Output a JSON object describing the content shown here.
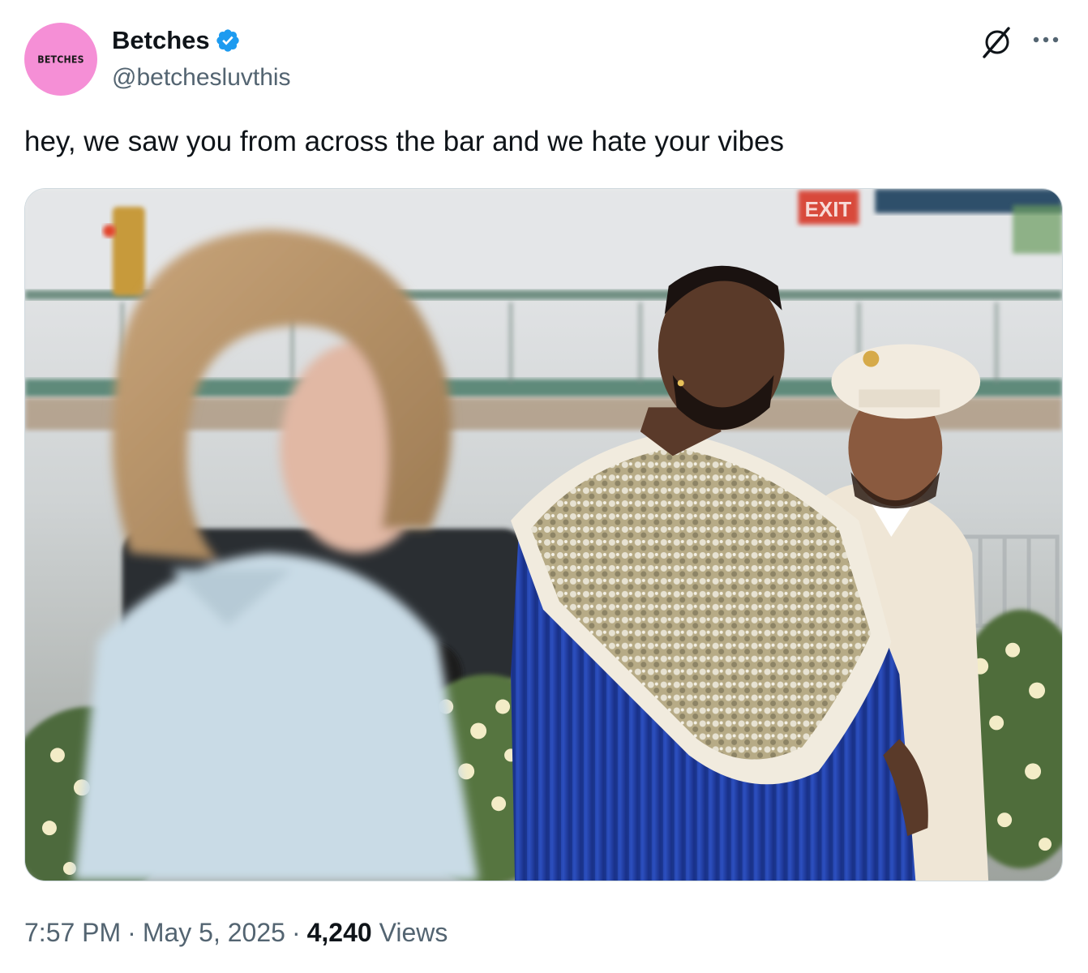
{
  "account": {
    "display_name": "Betches",
    "handle": "@betchesluvthis",
    "avatar_text": "BETCHES",
    "verified": true,
    "avatar_color": "#f58fd6",
    "verified_color": "#1d9bf0"
  },
  "icons": {
    "grok": "grok-icon",
    "more": "more-icon",
    "verified": "verified-badge-icon"
  },
  "tweet": {
    "text": "hey, we saw you from across the bar and we hate your vibes"
  },
  "media": {
    "sign_text": "EXIT"
  },
  "meta": {
    "time": "7:57 PM",
    "separator": "·",
    "date": "May 5, 2025",
    "views_count": "4,240",
    "views_label": "Views"
  },
  "colors": {
    "text_primary": "#0f1419",
    "text_secondary": "#536471"
  }
}
